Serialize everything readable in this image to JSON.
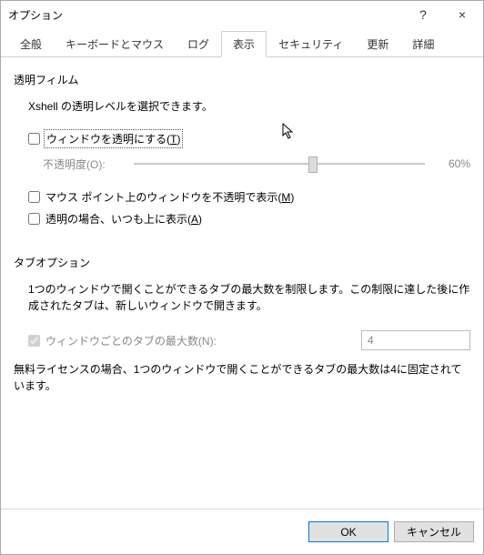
{
  "window": {
    "title": "オプション",
    "help": "?",
    "close": "×"
  },
  "tabs": [
    "全般",
    "キーボードとマウス",
    "ログ",
    "表示",
    "セキュリティ",
    "更新",
    "詳細"
  ],
  "active_tab_index": 3,
  "film": {
    "group": "透明フィルム",
    "desc": "Xshell の透明レベルを選択できます。",
    "make_transparent_pre": "ウィンドウを透明にする(",
    "make_transparent_hot": "T",
    "make_transparent_post": ")",
    "make_transparent_checked": false,
    "opacity_label_pre": "不透明度(",
    "opacity_label_hot": "O",
    "opacity_label_post": "):",
    "opacity_percent": 60,
    "opacity_display": "60%",
    "mouse_opaque_pre": "マウス ポイント上のウィンドウを不透明で表示(",
    "mouse_opaque_hot": "M",
    "mouse_opaque_post": ")",
    "mouse_opaque_checked": false,
    "always_top_pre": "透明の場合、いつも上に表示(",
    "always_top_hot": "A",
    "always_top_post": ")",
    "always_top_checked": false
  },
  "tabopt": {
    "group": "タブオプション",
    "desc": "1つのウィンドウで開くことができるタブの最大数を制限します。この制限に達した後に作成されたタブは、新しいウィンドウで開きます。",
    "max_tabs_pre": "ウィンドウごとのタブの最大数(",
    "max_tabs_hot": "N",
    "max_tabs_post": "):",
    "max_tabs_checked": true,
    "max_tabs_value": "4",
    "license_note": "無料ライセンスの場合、1つのウィンドウで開くことができるタブの最大数は4に固定されています。"
  },
  "buttons": {
    "ok": "OK",
    "cancel": "キャンセル"
  }
}
